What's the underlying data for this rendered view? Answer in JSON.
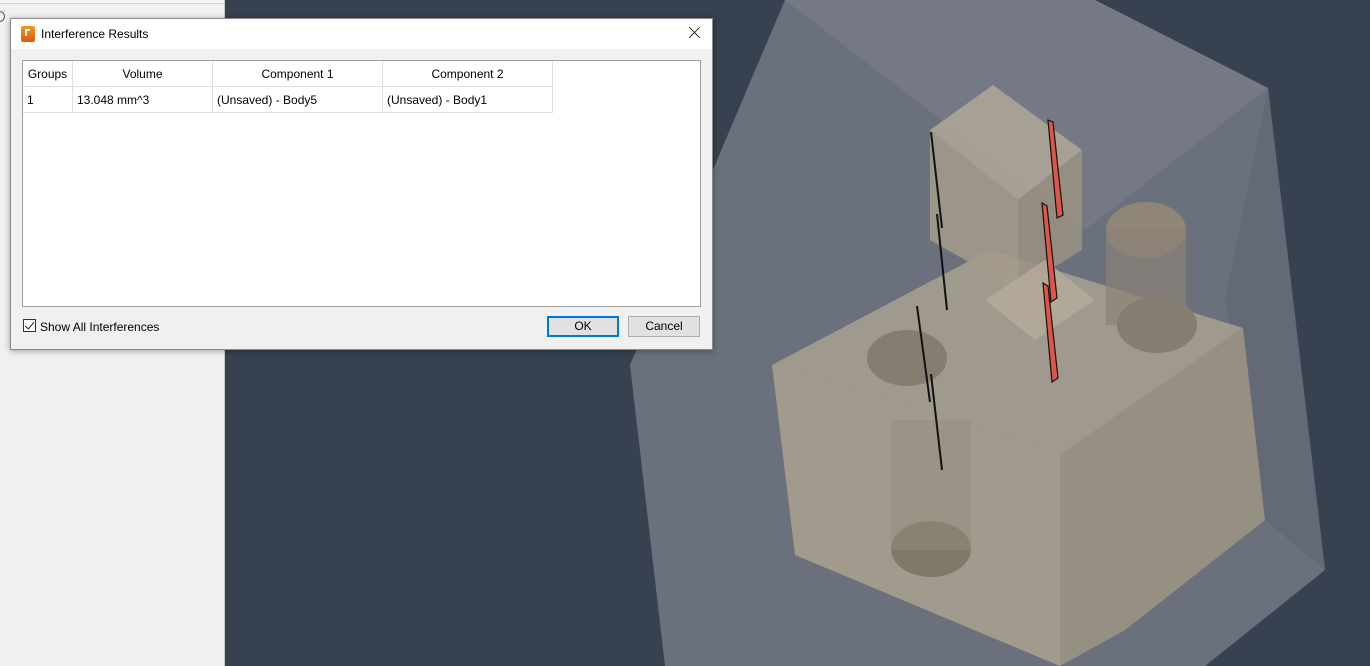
{
  "dialog": {
    "title": "Interference Results",
    "close_icon": "close-icon",
    "app_icon": "fusion-app-icon"
  },
  "table": {
    "columns": [
      "Groups",
      "Volume",
      "Component 1",
      "Component 2"
    ],
    "rows": [
      [
        "1",
        "13.048 mm^3",
        "(Unsaved) - Body5",
        "(Unsaved) - Body1"
      ]
    ]
  },
  "show_all": {
    "label": "Show All Interferences",
    "checked": true
  },
  "buttons": {
    "ok": "OK",
    "cancel": "Cancel"
  },
  "colors": {
    "viewport_bg": "#374150",
    "interference_red": "#e0554a",
    "accent": "#0078d7"
  }
}
